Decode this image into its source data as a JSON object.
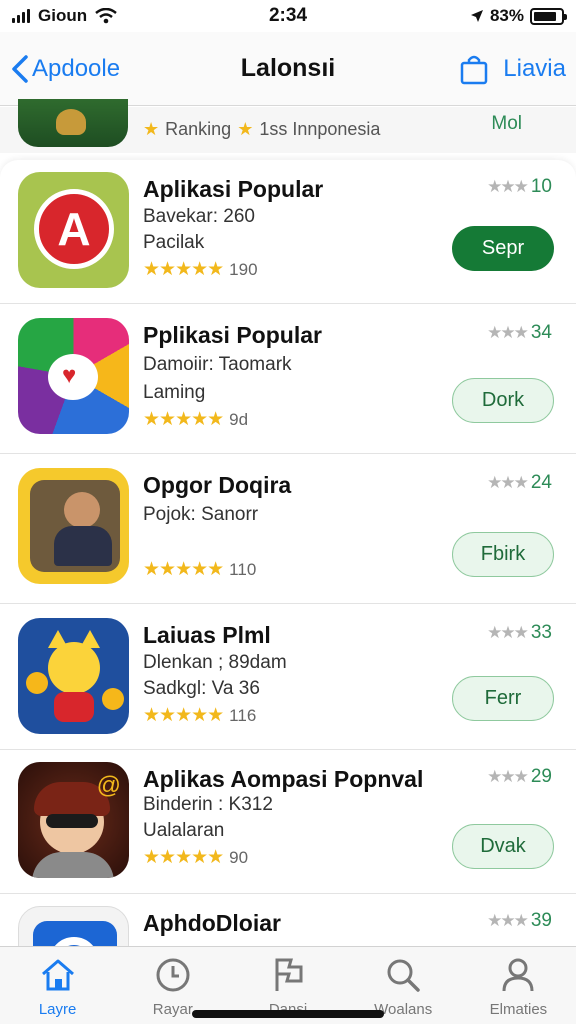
{
  "status_bar": {
    "carrier": "Gioun",
    "time": "2:34",
    "battery": "83%",
    "battery_level": 0.83
  },
  "nav": {
    "back_label": "Apdoole",
    "title": "Lalonsıi",
    "right_label": "Liavia"
  },
  "previous_row": {
    "ranking_text": "Ranking",
    "region_text": "1ss Innponesia",
    "right_text": "Mol"
  },
  "apps": [
    {
      "name": "Aplikasi Popular",
      "line1": "Bavekar: 260",
      "line2": "Pacilak",
      "stars": "★★★★★",
      "rating_count": "190",
      "score_stars": "★★★",
      "score": "10",
      "button": "Sepr",
      "button_style": "solid"
    },
    {
      "name": "Pplikasi Popular",
      "line1": "Damoiir: Taomark",
      "line2": "Laming",
      "stars": "★★★★★",
      "rating_count": "9d",
      "score_stars": "★★★",
      "score": "34",
      "button": "Dork",
      "button_style": "outline"
    },
    {
      "name": "Opgor Doqira",
      "line1": "Pojok: Sanorr",
      "line2": "",
      "stars": "★★★★★",
      "rating_count": "110",
      "score_stars": "★★★",
      "score": "24",
      "button": "Fbirk",
      "button_style": "outline"
    },
    {
      "name": "Laiuas Plml",
      "line1": "Dlenkan ; 89dam",
      "line2": "Sadkgl: Va 36",
      "stars": "★★★★★",
      "rating_count": "116",
      "score_stars": "★★★",
      "score": "33",
      "button": "Ferr",
      "button_style": "outline"
    },
    {
      "name": "Aplikas Aompasi Popnval",
      "line1": "Binderin : K312",
      "line2": "Ualalaran",
      "stars": "★★★★★",
      "rating_count": "90",
      "score_stars": "★★★",
      "score": "29",
      "button": "Dvak",
      "button_style": "outline"
    },
    {
      "name": "AphdoDloiar",
      "line1": "",
      "line2": "",
      "stars": "",
      "rating_count": "",
      "score_stars": "★★★",
      "score": "39",
      "button": "",
      "button_style": "none"
    }
  ],
  "tabs": [
    {
      "label": "Layre",
      "icon": "home-icon",
      "active": true
    },
    {
      "label": "Rayar",
      "icon": "clock-icon",
      "active": false
    },
    {
      "label": "Dansi",
      "icon": "flag-icon",
      "active": false
    },
    {
      "label": "Woalans",
      "icon": "search-icon",
      "active": false
    },
    {
      "label": "Elmaties",
      "icon": "person-icon",
      "active": false
    }
  ],
  "colors": {
    "accent": "#1a7cf0",
    "button_green": "#157a36",
    "star_yellow": "#f2b81c",
    "score_green": "#2d8b57"
  }
}
